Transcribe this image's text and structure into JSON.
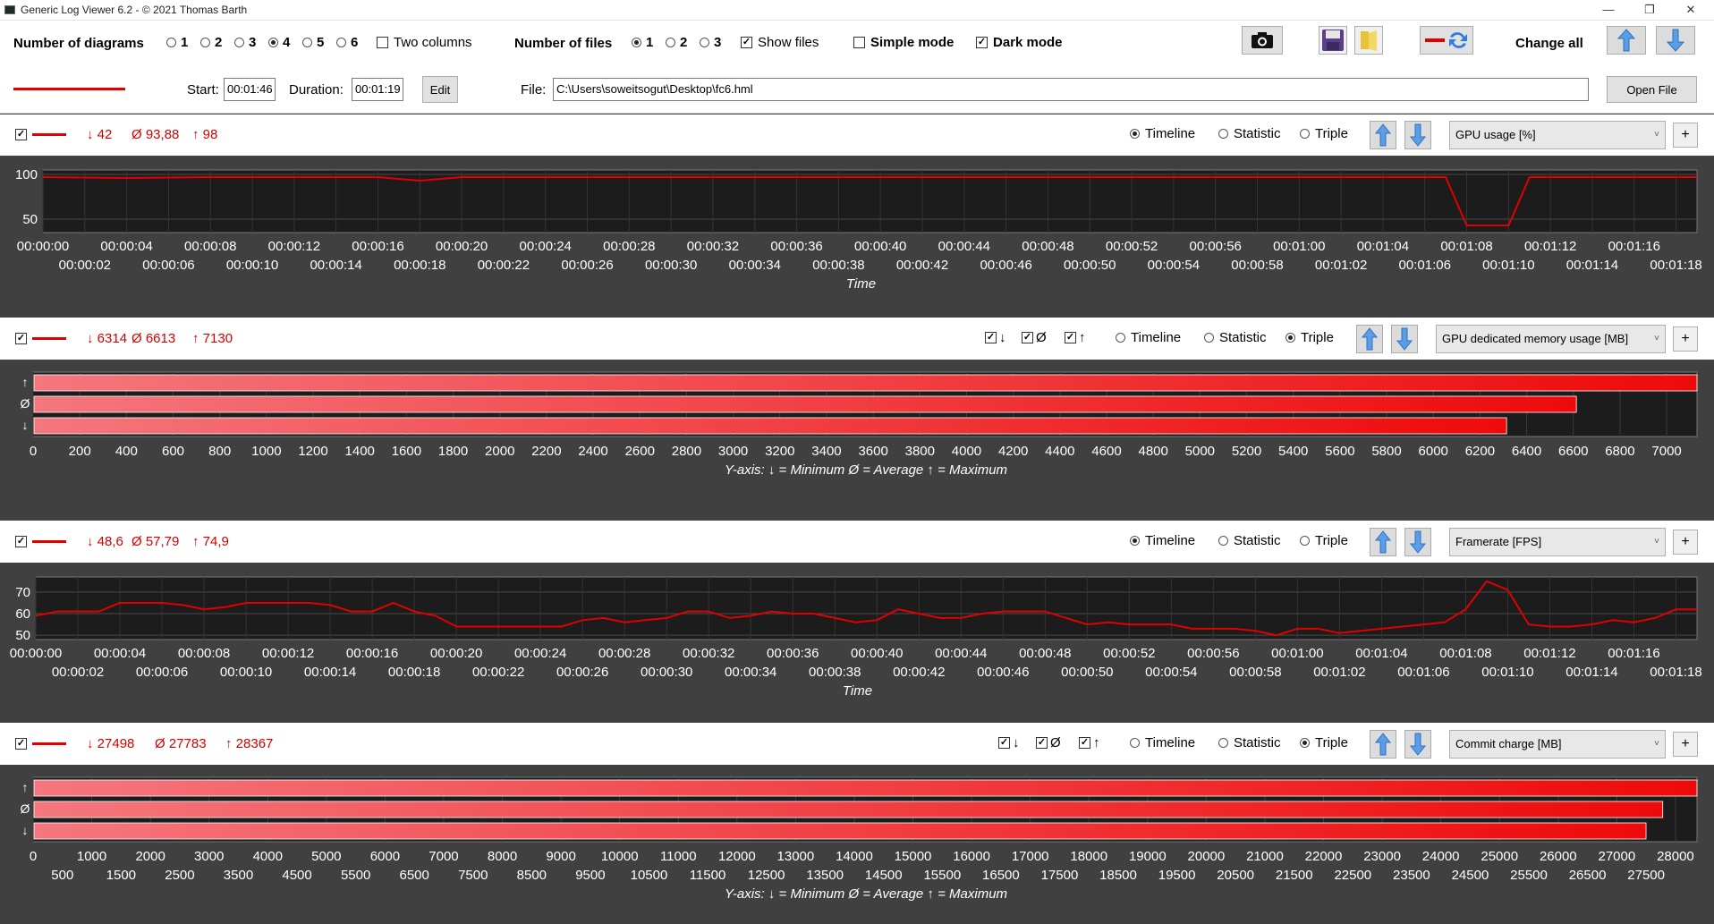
{
  "window": {
    "title": "Generic Log Viewer 6.2 - © 2021 Thomas Barth",
    "minimize": "—",
    "maximize": "❐",
    "close": "✕"
  },
  "toolbar": {
    "num_diagrams_label": "Number of diagrams",
    "diagram_options": [
      "1",
      "2",
      "3",
      "4",
      "5",
      "6"
    ],
    "diagram_selected": "4",
    "two_columns_label": "Two columns",
    "two_columns_checked": false,
    "num_files_label": "Number of files",
    "file_options": [
      "1",
      "2",
      "3"
    ],
    "file_selected": "1",
    "show_files_label": "Show files",
    "show_files_checked": true,
    "simple_mode_label": "Simple mode",
    "simple_mode_checked": false,
    "dark_mode_label": "Dark mode",
    "dark_mode_checked": true,
    "change_all_label": "Change all",
    "icons": [
      "camera-icon",
      "save-icon",
      "folder-icon",
      "swap-color-icon",
      "move-up-icon",
      "move-down-icon"
    ]
  },
  "file_bar": {
    "start_label": "Start:",
    "start_value": "00:01:46",
    "duration_label": "Duration:",
    "duration_value": "00:01:19",
    "edit_label": "Edit",
    "file_label": "File:",
    "file_value": "C:\\Users\\soweitsogut\\Desktop\\fc6.hml",
    "open_file_label": "Open File",
    "line_color": "#e00000"
  },
  "mode_labels": {
    "timeline": "Timeline",
    "statistic": "Statistic",
    "triple": "Triple"
  },
  "triple_check_labels": [
    "↓",
    "Ø",
    "↑"
  ],
  "panels": [
    {
      "stats": {
        "min": "↓ 42",
        "avg": "Ø 93,88",
        "max": "↑ 98"
      },
      "mode": "timeline",
      "metric": "GPU usage [%]"
    },
    {
      "stats": {
        "min": "↓ 6314",
        "avg": "Ø 6613",
        "max": "↑ 7130"
      },
      "mode": "triple",
      "metric": "GPU dedicated memory usage [MB]"
    },
    {
      "stats": {
        "min": "↓ 48,6",
        "avg": "Ø 57,79",
        "max": "↑ 74,9"
      },
      "mode": "timeline",
      "metric": "Framerate [FPS]"
    },
    {
      "stats": {
        "min": "↓ 27498",
        "avg": "Ø 27783",
        "max": "↑ 28367"
      },
      "mode": "triple",
      "metric": "Commit charge [MB]"
    }
  ],
  "chart_data": [
    {
      "type": "line",
      "title": "",
      "xlabel": "Time",
      "ylabel": "",
      "ylim": [
        35,
        105
      ],
      "yticks": [
        50,
        100
      ],
      "xticks_top": [
        "00:00:00",
        "00:00:04",
        "00:00:08",
        "00:00:12",
        "00:00:16",
        "00:00:20",
        "00:00:24",
        "00:00:28",
        "00:00:32",
        "00:00:36",
        "00:00:40",
        "00:00:44",
        "00:00:48",
        "00:00:52",
        "00:00:56",
        "00:01:00",
        "00:01:04",
        "00:01:08",
        "00:01:12",
        "00:01:16"
      ],
      "xticks_bottom": [
        "00:00:02",
        "00:00:06",
        "00:00:10",
        "00:00:14",
        "00:00:18",
        "00:00:22",
        "00:00:26",
        "00:00:30",
        "00:00:34",
        "00:00:38",
        "00:00:42",
        "00:00:46",
        "00:00:50",
        "00:00:54",
        "00:00:58",
        "00:01:02",
        "00:01:06",
        "00:01:10",
        "00:01:14",
        "00:01:18"
      ],
      "x_seconds": [
        0,
        4,
        8,
        12,
        16,
        18,
        20,
        24,
        28,
        32,
        36,
        40,
        44,
        48,
        52,
        56,
        60,
        64,
        66,
        67,
        68,
        70,
        71,
        72,
        74,
        76,
        78,
        79
      ],
      "series": [
        {
          "color": "#e00000",
          "values": [
            97,
            96,
            97,
            97,
            97,
            93,
            97,
            97,
            97,
            97,
            97,
            97,
            97,
            97,
            97,
            97,
            97,
            97,
            97,
            97,
            43,
            43,
            97,
            97,
            97,
            97,
            97,
            97
          ]
        }
      ]
    },
    {
      "type": "bar",
      "orientation": "horizontal",
      "title": "",
      "xlabel": "Y-axis:  ↓ = Minimum    Ø = Average    ↑ = Maximum",
      "xlim": [
        0,
        7130
      ],
      "xticks": [
        0,
        200,
        400,
        600,
        800,
        1000,
        1200,
        1400,
        1600,
        1800,
        2000,
        2200,
        2400,
        2600,
        2800,
        3000,
        3200,
        3400,
        3600,
        3800,
        4000,
        4200,
        4400,
        4600,
        4800,
        5000,
        5200,
        5400,
        5600,
        5800,
        6000,
        6200,
        6400,
        6600,
        6800,
        7000
      ],
      "categories": [
        "↑",
        "Ø",
        "↓"
      ],
      "values": [
        7130,
        6613,
        6314
      ]
    },
    {
      "type": "line",
      "title": "",
      "xlabel": "Time",
      "ylabel": "",
      "ylim": [
        48,
        77
      ],
      "yticks": [
        50,
        60,
        70
      ],
      "xticks_top": [
        "00:00:00",
        "00:00:04",
        "00:00:08",
        "00:00:12",
        "00:00:16",
        "00:00:20",
        "00:00:24",
        "00:00:28",
        "00:00:32",
        "00:00:36",
        "00:00:40",
        "00:00:44",
        "00:00:48",
        "00:00:52",
        "00:00:56",
        "00:01:00",
        "00:01:04",
        "00:01:08",
        "00:01:12",
        "00:01:16"
      ],
      "xticks_bottom": [
        "00:00:02",
        "00:00:06",
        "00:00:10",
        "00:00:14",
        "00:00:18",
        "00:00:22",
        "00:00:26",
        "00:00:30",
        "00:00:34",
        "00:00:38",
        "00:00:42",
        "00:00:46",
        "00:00:50",
        "00:00:54",
        "00:00:58",
        "00:01:02",
        "00:01:06",
        "00:01:10",
        "00:01:14",
        "00:01:18"
      ],
      "x_seconds": [
        0,
        1,
        3,
        4,
        6,
        7,
        8,
        9,
        10,
        11,
        12,
        13,
        14,
        15,
        16,
        17,
        18,
        19,
        20,
        21,
        22,
        23,
        24,
        25,
        26,
        27,
        28,
        29,
        30,
        31,
        32,
        33,
        34,
        35,
        36,
        37,
        38,
        39,
        40,
        41,
        42,
        43,
        44,
        45,
        46,
        47,
        48,
        49,
        50,
        51,
        52,
        53,
        54,
        55,
        56,
        57,
        58,
        59,
        60,
        61,
        62,
        63,
        64,
        65,
        66,
        67,
        68,
        69,
        70,
        71,
        72,
        73,
        74,
        75,
        76,
        77,
        78,
        79
      ],
      "series": [
        {
          "color": "#e00000",
          "values": [
            59,
            61,
            61,
            65,
            65,
            64,
            62,
            63,
            65,
            65,
            65,
            65,
            64,
            61,
            61,
            65,
            61,
            59,
            54,
            54,
            54,
            54,
            54,
            54,
            57,
            58,
            56,
            57,
            58,
            61,
            61,
            58,
            59,
            61,
            60,
            60,
            58,
            56,
            57,
            62,
            60,
            58,
            58,
            60,
            61,
            61,
            61,
            58,
            55,
            56,
            55,
            55,
            55,
            53,
            53,
            53,
            52,
            50,
            53,
            53,
            51,
            52,
            53,
            54,
            55,
            56,
            62,
            75,
            71,
            55,
            54,
            54,
            55,
            57,
            56,
            58,
            62,
            62
          ]
        }
      ]
    },
    {
      "type": "bar",
      "orientation": "horizontal",
      "title": "",
      "xlabel": "Y-axis:  ↓ = Minimum    Ø = Average    ↑ = Maximum",
      "xlim": [
        0,
        28367
      ],
      "xticks_top": [
        0,
        1000,
        2000,
        3000,
        4000,
        5000,
        6000,
        7000,
        8000,
        9000,
        10000,
        11000,
        12000,
        13000,
        14000,
        15000,
        16000,
        17000,
        18000,
        19000,
        20000,
        21000,
        22000,
        23000,
        24000,
        25000,
        26000,
        27000,
        28000
      ],
      "xticks_bottom": [
        500,
        1500,
        2500,
        3500,
        4500,
        5500,
        6500,
        7500,
        8500,
        9500,
        10500,
        11500,
        12500,
        13500,
        14500,
        15500,
        16500,
        17500,
        18500,
        19500,
        20500,
        21500,
        22500,
        23500,
        24500,
        25500,
        26500,
        27500
      ],
      "categories": [
        "↑",
        "Ø",
        "↓"
      ],
      "values": [
        28367,
        27783,
        27498
      ]
    }
  ]
}
